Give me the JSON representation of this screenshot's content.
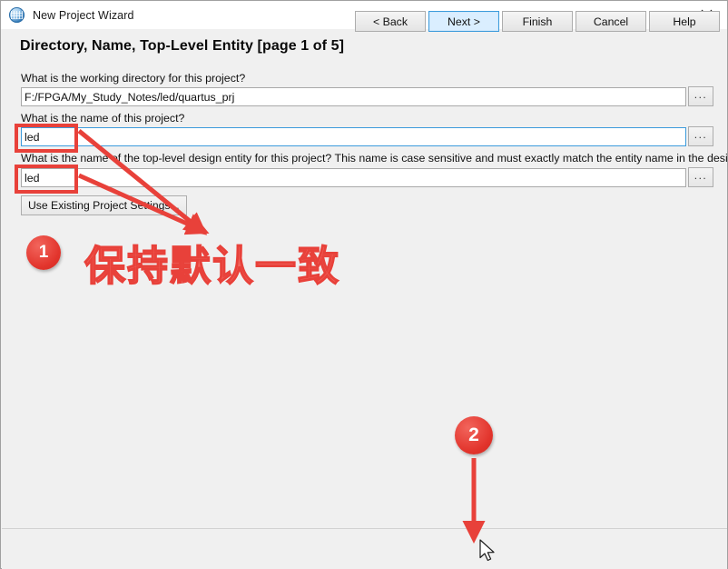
{
  "window": {
    "title": "New Project Wizard",
    "icon": "globe-icon",
    "close_label": "×"
  },
  "header": {
    "page_title": "Directory, Name, Top-Level Entity [page 1 of 5]"
  },
  "form": {
    "fields": [
      {
        "label": "What is the working directory for this project?",
        "value": "F:/FPGA/My_Study_Notes/led/quartus_prj",
        "browse_label": "...",
        "focused": false
      },
      {
        "label": "What is the name of this project?",
        "value": "led",
        "browse_label": "...",
        "focused": true
      },
      {
        "label": "What is the name of the top-level design entity for this project? This name is case sensitive and must exactly match the entity name in the design file.",
        "value": "led",
        "browse_label": "...",
        "focused": false
      }
    ],
    "use_existing_label": "Use Existing Project Settings..."
  },
  "footer": {
    "buttons": [
      {
        "label": "< Back",
        "state": "normal"
      },
      {
        "label": "Next >",
        "state": "hover"
      },
      {
        "label": "Finish",
        "state": "normal"
      },
      {
        "label": "Cancel",
        "state": "normal"
      },
      {
        "label": "Help",
        "state": "normal"
      }
    ]
  },
  "annotations": {
    "badge_1": "1",
    "badge_2": "2",
    "note_text": "保持默认一致",
    "accent_color": "#e8413a"
  }
}
